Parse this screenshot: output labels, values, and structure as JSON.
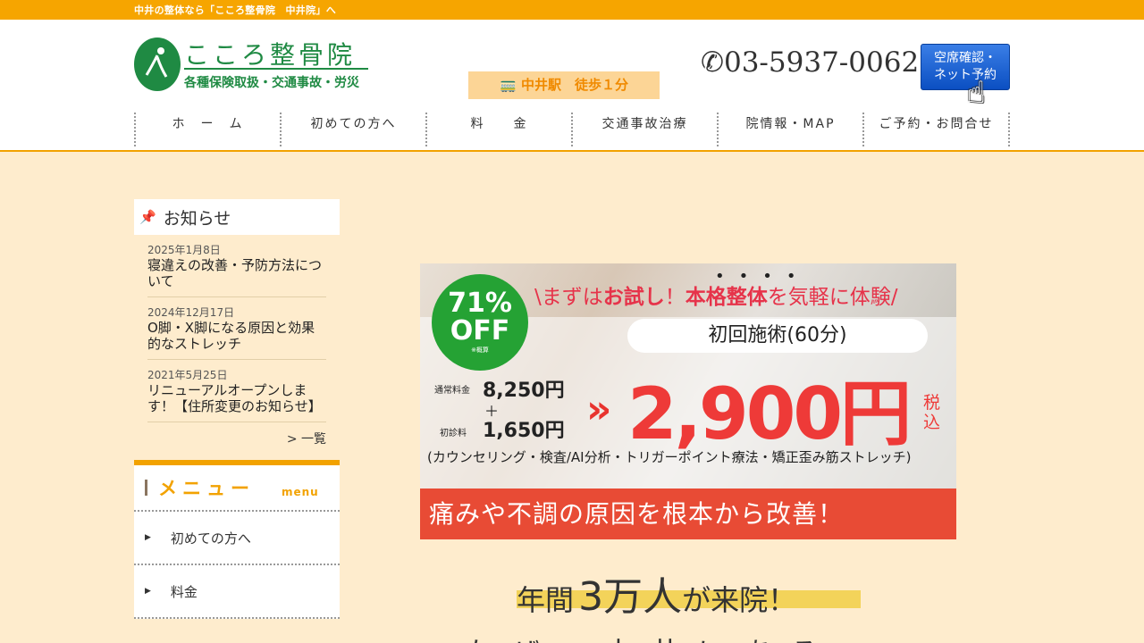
{
  "topbar": {
    "text": "中井の整体なら「こころ整骨院　中井院」へ"
  },
  "header": {
    "logo_name": "こころ整骨院",
    "logo_sub": "各種保険取扱・交通事故・労災",
    "station": "中井駅　徒歩１分",
    "phone": "03-5937-0062",
    "reserve_label_1": "空席確認・",
    "reserve_label_2": "ネット予約"
  },
  "nav": {
    "items": [
      "ホ　ー　ム",
      "初めての方へ",
      "料　　金",
      "交通事故治療",
      "院情報・MAP",
      "ご予約・お問合せ"
    ]
  },
  "news": {
    "heading": "お知らせ",
    "items": [
      {
        "date": "2025年1月8日",
        "title": "寝違えの改善・予防方法について"
      },
      {
        "date": "2024年12月17日",
        "title": "O脚・X脚になる原因と効果的なストレッチ"
      },
      {
        "date": "2021年5月25日",
        "title": "リニューアルオープンします！【住所変更のお知らせ】"
      }
    ],
    "more": "> 一覧"
  },
  "menu": {
    "heading": "メニュー",
    "heading_en": "menu",
    "items": [
      "初めての方へ",
      "料金"
    ]
  },
  "banner": {
    "off_pct": "71%",
    "off_label": "OFF",
    "off_note": "※概算",
    "catch_1": "\\まずは",
    "catch_2": "お試し",
    "catch_3": "！",
    "catch_4": "本格整体",
    "catch_5": "を気軽に体験/",
    "first_session": "初回施術(60分)",
    "regular_label": "通常料金",
    "regular_price": "8,250円",
    "plus": "＋",
    "first_label": "初診料",
    "first_price": "1,650円",
    "arrow": "»",
    "price": "2,900円",
    "tax": "税込",
    "includes": "(カウンセリング・検査/AI分析・トリガーポイント療法・矯正歪み筋ストレッチ)",
    "tagline": "痛みや不調の原因を根本から改善！"
  },
  "main": {
    "visits_pre": "年間",
    "visits_num": "3万人",
    "visits_post": "が来院！",
    "partial_text": "なぜ、中井にある"
  },
  "colors": {
    "accent": "#f2a200",
    "brand_green": "#1f8a43",
    "price_red": "#ee3a38",
    "background": "#feeccd"
  }
}
